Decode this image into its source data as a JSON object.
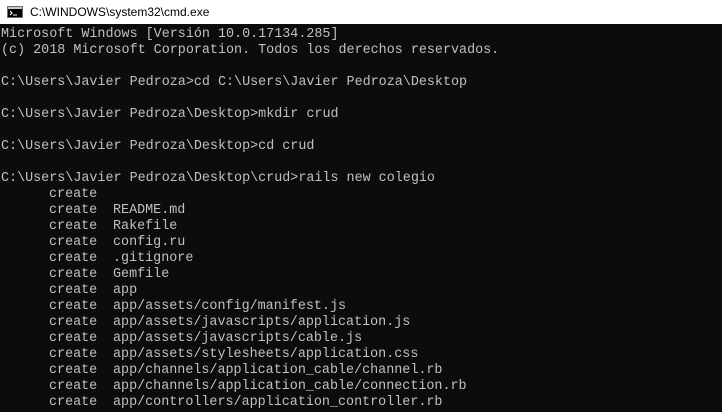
{
  "window": {
    "title": "C:\\WINDOWS\\system32\\cmd.exe",
    "icon": "cmd-icon",
    "colors": {
      "console_bg": "#0c0c0c",
      "console_text": "#c0c0c0",
      "titlebar_bg": "#ffffff"
    }
  },
  "console": {
    "header": [
      "Microsoft Windows [Versión 10.0.17134.285]",
      "(c) 2018 Microsoft Corporation. Todos los derechos reservados."
    ],
    "commands": [
      {
        "prompt": "C:\\Users\\Javier Pedroza>",
        "command": "cd C:\\Users\\Javier Pedroza\\Desktop"
      },
      {
        "prompt": "C:\\Users\\Javier Pedroza\\Desktop>",
        "command": "mkdir crud"
      },
      {
        "prompt": "C:\\Users\\Javier Pedroza\\Desktop>",
        "command": "cd crud"
      },
      {
        "prompt": "C:\\Users\\Javier Pedroza\\Desktop\\crud>",
        "command": "rails new colegio"
      }
    ],
    "output": [
      {
        "verb": "create",
        "path": ""
      },
      {
        "verb": "create",
        "path": "README.md"
      },
      {
        "verb": "create",
        "path": "Rakefile"
      },
      {
        "verb": "create",
        "path": "config.ru"
      },
      {
        "verb": "create",
        "path": ".gitignore"
      },
      {
        "verb": "create",
        "path": "Gemfile"
      },
      {
        "verb": "create",
        "path": "app"
      },
      {
        "verb": "create",
        "path": "app/assets/config/manifest.js"
      },
      {
        "verb": "create",
        "path": "app/assets/javascripts/application.js"
      },
      {
        "verb": "create",
        "path": "app/assets/javascripts/cable.js"
      },
      {
        "verb": "create",
        "path": "app/assets/stylesheets/application.css"
      },
      {
        "verb": "create",
        "path": "app/channels/application_cable/channel.rb"
      },
      {
        "verb": "create",
        "path": "app/channels/application_cable/connection.rb"
      },
      {
        "verb": "create",
        "path": "app/controllers/application_controller.rb"
      }
    ]
  }
}
